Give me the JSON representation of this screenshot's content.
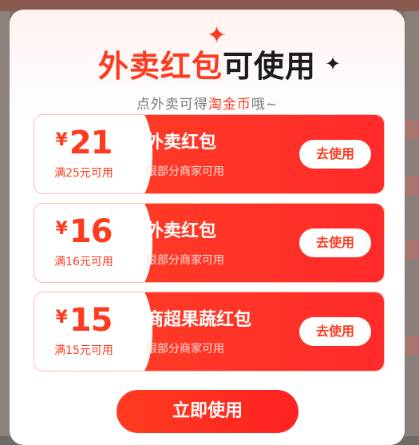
{
  "modal": {
    "title_red": "外卖红包",
    "title_black": "可使用",
    "subtitle_prefix": "点外卖可得",
    "subtitle_highlight": "淘金币",
    "subtitle_suffix": "哦~",
    "sparkle_big": "✦",
    "sparkle_small": "✦",
    "coupons": [
      {
        "currency": "¥",
        "amount": "21",
        "condition": "满25元可用",
        "title": "外卖红包",
        "desc": "限部分商家可用",
        "button": "去使用"
      },
      {
        "currency": "¥",
        "amount": "16",
        "condition": "满16元可用",
        "title": "外卖红包",
        "desc": "限部分商家可用",
        "button": "去使用"
      },
      {
        "currency": "¥",
        "amount": "15",
        "condition": "满15元可用",
        "title": "商超果蔬红包",
        "desc": "限部分商家可用",
        "button": "去使用"
      }
    ],
    "cta_label": "立即使用"
  },
  "colors": {
    "accent": "#ff3b1f",
    "overlay": "#7a7471"
  }
}
